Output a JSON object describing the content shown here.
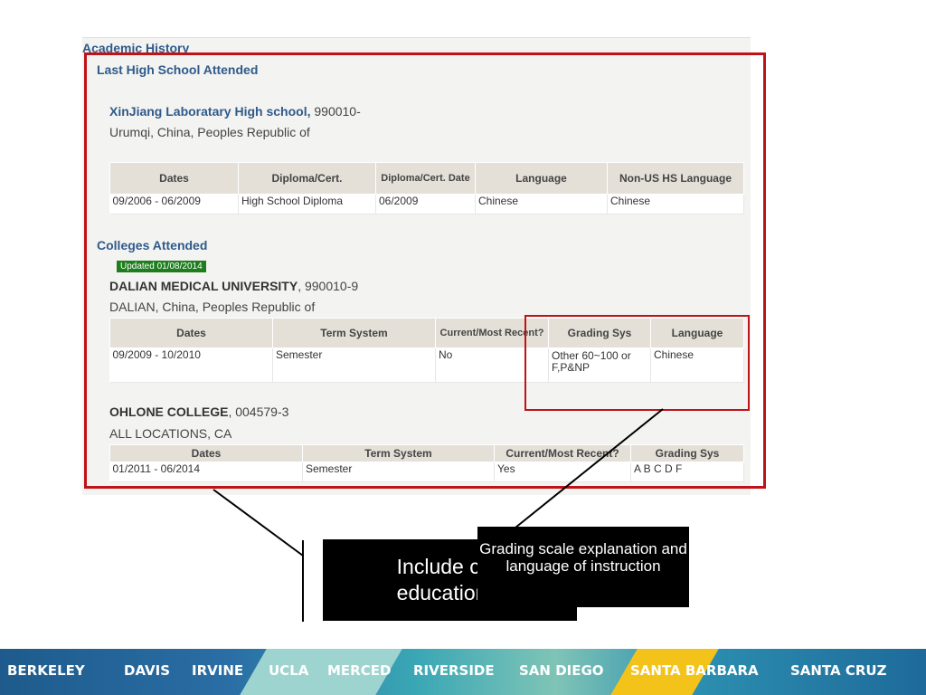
{
  "academic_history": {
    "title": "Academic History",
    "high_school": {
      "section_title": "Last High School Attended",
      "name": "XinJiang Laboratary High school,",
      "code": " 990010-",
      "location": "Urumqi, China, Peoples Republic of",
      "columns": [
        "Dates",
        "Diploma/Cert.",
        "Diploma/Cert. Date",
        "Language",
        "Non-US HS Language"
      ],
      "row": [
        "09/2006 - 06/2009",
        "High School Diploma",
        "06/2009",
        "Chinese",
        "Chinese"
      ]
    },
    "colleges": {
      "section_title": "Colleges Attended",
      "updated_badge": "Updated 01/08/2014",
      "college1": {
        "name": "DALIAN MEDICAL UNIVERSITY",
        "code": ", 990010-9",
        "location": "DALIAN, China, Peoples Republic of",
        "columns": [
          "Dates",
          "Term System",
          "Current/Most Recent?",
          "Grading Sys",
          "Language"
        ],
        "row": [
          "09/2009 - 10/2010",
          "Semester",
          "No",
          "Other 60~100 or F,P&NP",
          "Chinese"
        ]
      },
      "college2": {
        "name": "OHLONE COLLEGE",
        "code": ", 004579-3",
        "location": "ALL LOCATIONS, CA",
        "columns": [
          "Dates",
          "Term System",
          "Current/Most Recent?",
          "Grading Sys"
        ],
        "row": [
          "01/2011 - 06/2014",
          "Semester",
          "Yes",
          "A B C D F"
        ]
      }
    }
  },
  "callouts": {
    "callout1_line1": "Include con",
    "callout1_line2": "educational",
    "callout2_text": "Grading scale explanation and language of instruction"
  },
  "footer": {
    "campuses": [
      "BERKELEY",
      "DAVIS",
      "IRVINE",
      "UCLA",
      "MERCED",
      "RIVERSIDE",
      "SAN DIEGO",
      "SANTA BARBARA",
      "SANTA CRUZ"
    ]
  },
  "colors": {
    "frame_red": "#c01217",
    "heading_blue": "#2f5a8a",
    "badge_green": "#1e7d1e",
    "footer_yellow": "#f4c31a"
  }
}
